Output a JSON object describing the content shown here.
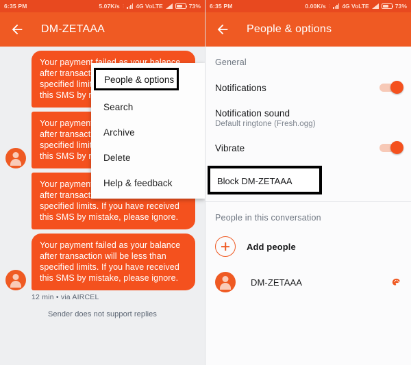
{
  "left": {
    "status_bar": {
      "time": "6:35 PM",
      "net_speed": "5.07K/s",
      "network": "4G VoLTE",
      "battery": "73%"
    },
    "toolbar": {
      "back_icon": "back-arrow-icon",
      "title": "DM-ZETAAA"
    },
    "menu": {
      "highlighted_item": "People & options",
      "items": [
        {
          "label": "People & options"
        },
        {
          "label": "Search"
        },
        {
          "label": "Archive"
        },
        {
          "label": "Delete"
        },
        {
          "label": "Help & feedback"
        }
      ]
    },
    "messages": [
      {
        "text": "Your payment failed as your balance after transaction will be less than specified limits. If you have received this SMS by mistake, please ignore."
      },
      {
        "text": "Your payment failed as your balance after transaction will be less than specified limits. If you have received this SMS by mistake, please ignore."
      },
      {
        "text": "Your payment failed as your balance after transaction will be less than specified limits. If you have received this SMS by mistake, please ignore."
      },
      {
        "text": "Your payment failed as your balance after transaction will be less than specified limits. If you have received this SMS by mistake, please ignore."
      }
    ],
    "message_meta": "12 min • via AIRCEL",
    "thread_note": "Sender does not support replies"
  },
  "right": {
    "status_bar": {
      "time": "6:35 PM",
      "net_speed": "0.00K/s",
      "network": "4G VoLTE",
      "battery": "73%"
    },
    "toolbar": {
      "back_icon": "back-arrow-icon",
      "title": "People & options"
    },
    "section_general": "General",
    "settings": [
      {
        "title": "Notifications",
        "subtitle": "",
        "toggle": "on"
      },
      {
        "title": "Notification sound",
        "subtitle": "Default ringtone (Fresh.ogg)",
        "toggle": "none"
      },
      {
        "title": "Vibrate",
        "subtitle": "",
        "toggle": "on"
      }
    ],
    "block_label": "Block DM-ZETAAA",
    "people_section": "People in this conversation",
    "add_people": "Add people",
    "participant": "DM-ZETAAA",
    "palette_icon": "palette-icon"
  },
  "colors": {
    "accent": "#ef5a23",
    "bubble": "#f4511e",
    "status_bar": "#e8491f",
    "thread_bg": "#eeeff1",
    "settings_bg": "#fbfbfc",
    "highlight_box": "#000000"
  }
}
